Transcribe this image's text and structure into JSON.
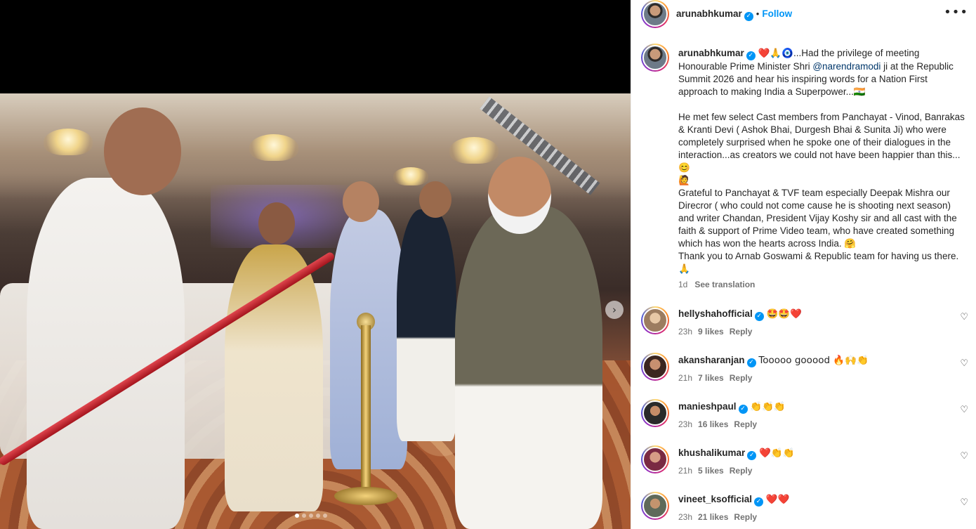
{
  "post": {
    "author": "arunabhkumar",
    "follow_label": "Follow",
    "separator": "•",
    "more_label": "•••",
    "verified_mark": "✓"
  },
  "carousel": {
    "next_label": "›",
    "slide_count": 5,
    "active_index": 0
  },
  "caption": {
    "author": "arunabhkumar",
    "emojis": "❤️🙏🧿",
    "p1_before": "...Had the privilege of meeting Honourable Prime Minister Shri ",
    "mention": "@narendramodi",
    "p1_after": " ji at the Republic Summit 2026 and hear his inspiring words for a Nation First approach to making India a Superpower...🇮🇳",
    "p2": "He met few select Cast members from Panchayat - Vinod, Banrakas & Kranti Devi ( Ashok Bhai, Durgesh Bhai & Sunita Ji) who were completely surprised when he spoke one of their dialogues in the interaction...as creators we could not have been happier than this...😊",
    "p3": "🙋",
    "p4": "Grateful to Panchayat & TVF team especially Deepak Mishra our Direcror ( who could not come cause he is shooting next season) and writer Chandan, President Vijay Koshy sir and all cast with the faith & support of Prime Video team, who have created something which has won the hearts across India. 🤗",
    "p5": "Thank you to Arnab Goswami & Republic team for having us there. 🙏",
    "time": "1d",
    "see_translation": "See translation"
  },
  "comments": [
    {
      "user": "hellyshahofficial",
      "text": "🤩🤩❤️",
      "time": "23h",
      "likes": "9 likes",
      "reply": "Reply"
    },
    {
      "user": "akansharanjan",
      "text": "Tooooo gooood 🔥🙌👏",
      "time": "21h",
      "likes": "7 likes",
      "reply": "Reply"
    },
    {
      "user": "manieshpaul",
      "text": "👏👏👏",
      "time": "23h",
      "likes": "16 likes",
      "reply": "Reply"
    },
    {
      "user": "khushalikumar",
      "text": "❤️👏👏",
      "time": "21h",
      "likes": "5 likes",
      "reply": "Reply"
    },
    {
      "user": "vineet_ksofficial",
      "text": "❤️❤️",
      "time": "23h",
      "likes": "21 likes",
      "reply": "Reply"
    }
  ],
  "icons": {
    "heart": "♡"
  }
}
